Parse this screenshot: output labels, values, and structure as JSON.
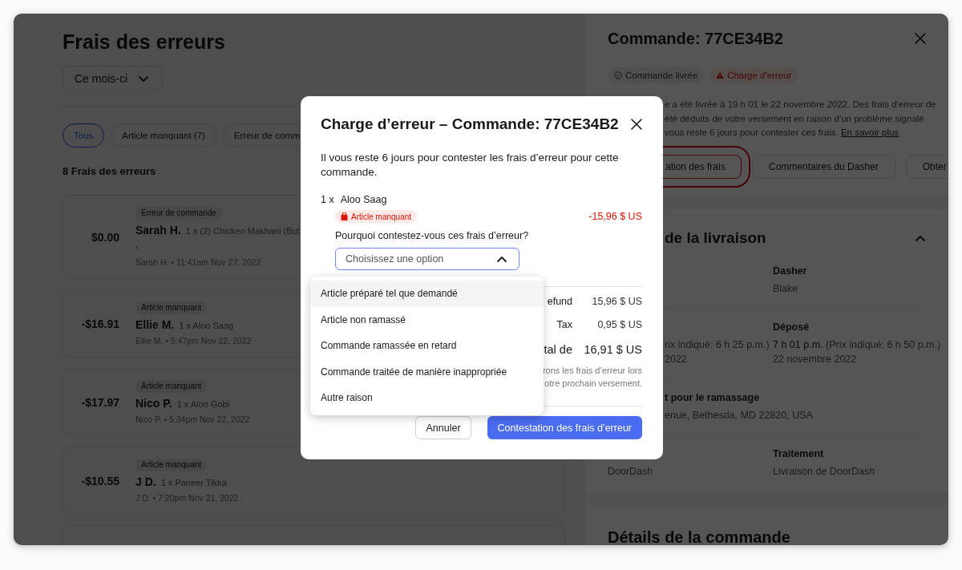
{
  "charges_page": {
    "title": "Frais des erreurs",
    "period": {
      "label": "Ce mois-ci",
      "expanded": false
    },
    "filters": [
      {
        "label": "Tous",
        "selected": true
      },
      {
        "label": "Article manquant (7)",
        "selected": false
      },
      {
        "label": "Erreur de comm",
        "selected": false
      }
    ],
    "count": "8 Frais des erreurs",
    "charges": [
      {
        "amount": "$0.00",
        "tag": "Erreur de commande",
        "customer": "Sarah H.",
        "item": "1 x (2) Chicken Makhani (But",
        "note": ",",
        "meta": "Sarah H. • 11:41am Nov 27, 2022"
      },
      {
        "amount": "-$16.91",
        "tag": "Article manquant",
        "customer": "Ellie M.",
        "item": "1 x Aloo Saag",
        "meta": "Ellie M. • 5:47pm Nov 22, 2022"
      },
      {
        "amount": "-$17.97",
        "tag": "Article manquant",
        "customer": "Nico P.",
        "item": "1 x Aloo Gobi",
        "meta": "Nico P. • 5:34pm Nov 22, 2022"
      },
      {
        "amount": "-$10.55",
        "tag": "Article manquant",
        "customer": "J D.",
        "item": "1 x Paneer Tikka",
        "meta": "J D. • 7:20pm Nov 21, 2022"
      }
    ]
  },
  "order_panel": {
    "title": "Commande: 77CE34B2",
    "chips": [
      {
        "kind": "delivered",
        "label": "Commande livrée"
      },
      {
        "kind": "error",
        "label": "Charge d'erreur"
      }
    ],
    "description": [
      "e a été livrée à 19 h 01 le 22 novembre 2022. Des frais d'erreur de",
      "été déduits de votre versement en raison d'un problème signalé",
      "vous reste 6 jours pour contester ces frais."
    ],
    "link": "En savoir plus",
    "actions": [
      {
        "label": "ation des frais",
        "highlighted": true
      },
      {
        "label": "Commentaires du Dasher",
        "highlighted": false
      },
      {
        "label": "Obter",
        "highlighted": false
      }
    ],
    "delivery": {
      "heading": "de la livraison",
      "expanded": true,
      "rows": [
        {
          "right": {
            "covered": false,
            "label": "Dasher",
            "lines": [
              "Blake"
            ]
          }
        },
        {
          "left": {
            "covered": true,
            "lines": [
              "rix indiqué: 6 h 25 p.m.)",
              "2022"
            ]
          },
          "right": {
            "covered": false,
            "label": "Déposé",
            "lines": [
              "**7 h 01 p.m.** (Prix indiqué: 6 h 50 p.m.)",
              "22 novembre 2022"
            ]
          }
        },
        {
          "full": {
            "covered": true,
            "label": "t pour le ramassage",
            "lines": [
              "enue, Bethesda, MD 22820, USA"
            ]
          }
        },
        {
          "left": {
            "covered": false,
            "lines": [
              "DoorDash"
            ]
          },
          "right": {
            "covered": false,
            "label": "Traitement",
            "lines": [
              "Livraison de DoorDash"
            ]
          }
        }
      ]
    },
    "details_heading": "Détails de la commande"
  },
  "dialog": {
    "title": "Charge d’erreur – Commande: 77CE34B2",
    "message": "Il vous reste 6 jours pour contester les frais d’erreur pour cette commande.",
    "item": {
      "quantity": "1 x",
      "name": "Aloo Saag",
      "badge": "Article manquant",
      "amount": "-15,96 $ US"
    },
    "question": "Pourquoi contestez-vous ces frais d’erreur?",
    "select": {
      "placeholder": "Choisissez une option",
      "expanded": true,
      "options": [
        {
          "label": "Article préparé tel que demandé",
          "hovered": true
        },
        {
          "label": "Article non ramassé",
          "hovered": false
        },
        {
          "label": "Commande ramassée en retard",
          "hovered": false
        },
        {
          "label": "Commande traitée de manière inappropriée",
          "hovered": false
        },
        {
          "label": "Autre raison",
          "hovered": false
        }
      ]
    },
    "summary": [
      {
        "label": "efund",
        "value": "15,96 $ US",
        "emphasis": false
      },
      {
        "label": "Tax",
        "value": "0,95 $ US",
        "emphasis": false
      },
      {
        "label": "tal de",
        "value": "16,91 $ US",
        "emphasis": true
      }
    ],
    "note": [
      "rons les frais d’erreur lors",
      "otre prochain versement."
    ],
    "buttons": [
      {
        "kind": "secondary",
        "label": "Annuler"
      },
      {
        "kind": "primary",
        "label": "Contestation des frais d’erreur"
      }
    ]
  }
}
